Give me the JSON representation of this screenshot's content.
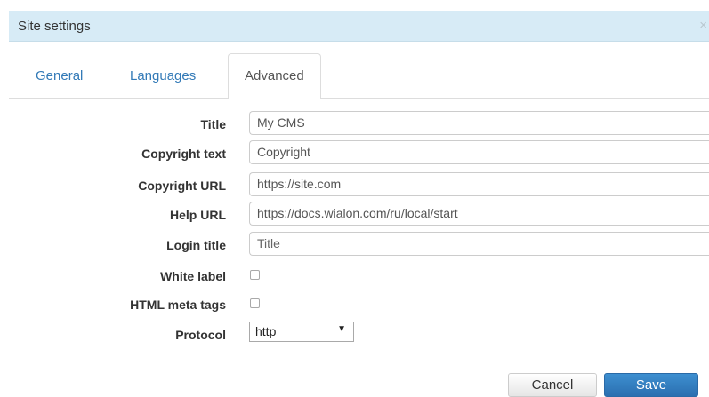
{
  "dialog": {
    "title": "Site settings",
    "close_glyph": "×"
  },
  "tabs": [
    {
      "label": "General",
      "active": false
    },
    {
      "label": "Languages",
      "active": false
    },
    {
      "label": "Advanced",
      "active": true
    }
  ],
  "form": {
    "title": {
      "label": "Title",
      "value": "My CMS"
    },
    "copyright_text": {
      "label": "Copyright text",
      "value": "Copyright"
    },
    "copyright_url": {
      "label": "Copyright URL",
      "value": "https://site.com"
    },
    "help_url": {
      "label": "Help URL",
      "value": "https://docs.wialon.com/ru/local/start"
    },
    "login_title": {
      "label": "Login title",
      "value": "",
      "placeholder": "Title"
    },
    "white_label": {
      "label": "White label",
      "checked": false
    },
    "html_meta_tags": {
      "label": "HTML meta tags",
      "checked": false
    },
    "protocol": {
      "label": "Protocol",
      "value": "http",
      "arrow": "▼"
    }
  },
  "buttons": {
    "cancel": "Cancel",
    "save": "Save"
  },
  "colors": {
    "titlebar_bg": "#d7ebf6",
    "link": "#337ab7",
    "save_bg": "#2b6fb0"
  }
}
